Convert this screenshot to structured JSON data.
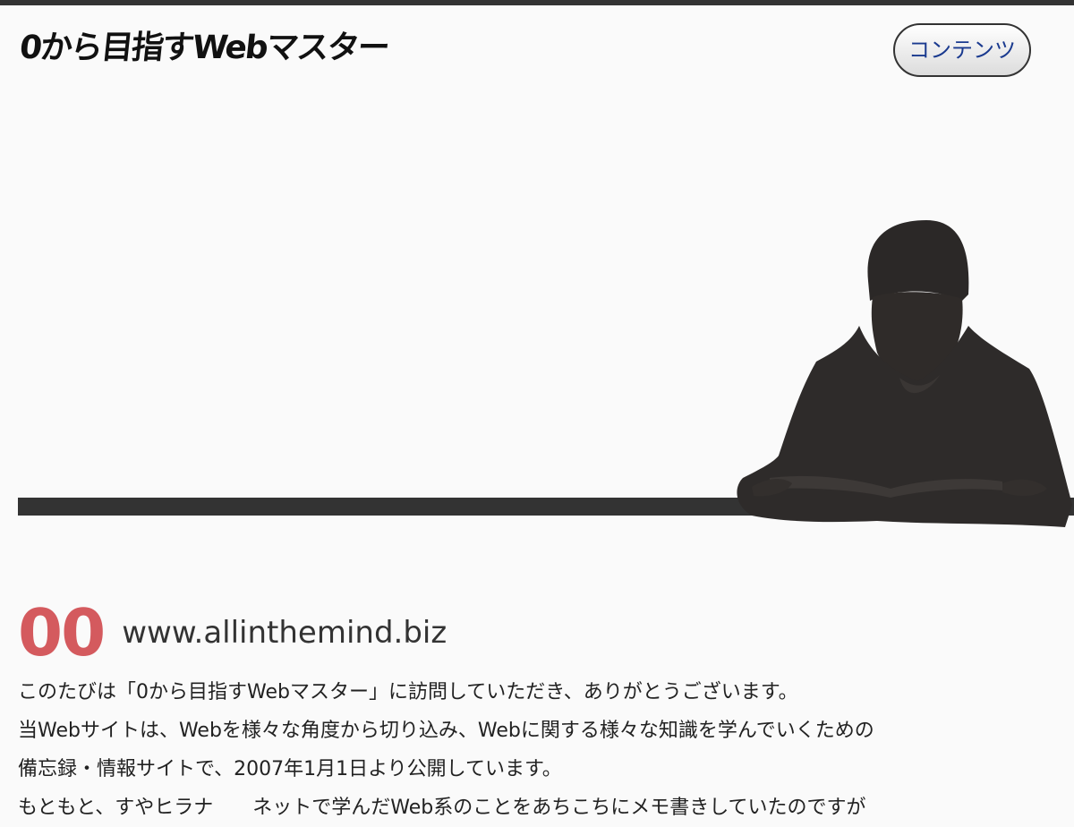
{
  "header": {
    "logo_text": "0から目指すWebマスター",
    "nav_button_label": "コンテンツ"
  },
  "section": {
    "number": "00",
    "title": "www.allinthemind.biz"
  },
  "intro_lines": [
    "このたびは「0から目指すWebマスター」に訪問していただき、ありがとうございます。",
    "当Webサイトは、Webを様々な角度から切り込み、Webに関する様々な知識を学んでいくための",
    "備忘録・情報サイトで、2007年1月1日より公開しています。",
    "もともと、すやヒラナ　　ネットで学んだWeb系のことをあちこちにメモ書きしていたのですが"
  ],
  "colors": {
    "accent_number": "#d45a5e",
    "bar": "#333333",
    "button_text": "#1a3a8f"
  },
  "icons": {
    "hero_figure": "person-reading-silhouette"
  }
}
